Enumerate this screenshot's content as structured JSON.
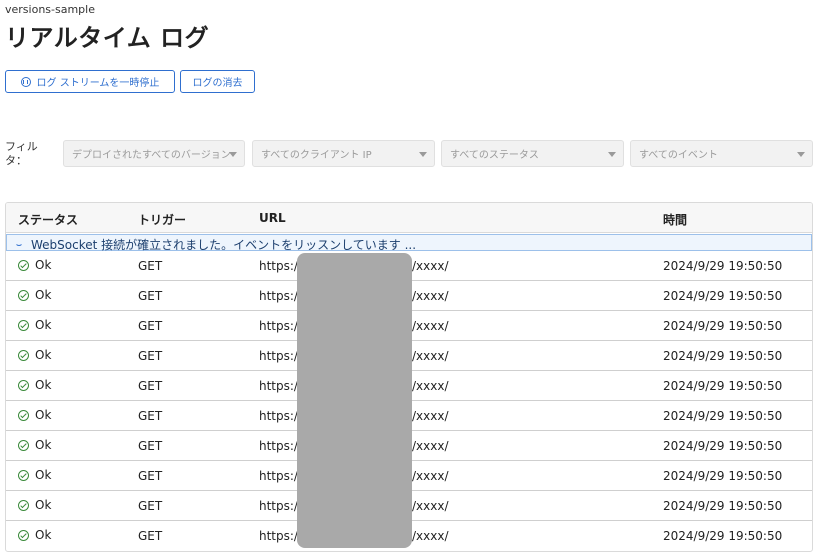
{
  "header": {
    "app_name": "versions-sample",
    "title": "リアルタイム ログ"
  },
  "toolbar": {
    "pause_label": "ログ ストリームを一時停止",
    "clear_label": "ログの消去"
  },
  "filters": {
    "label": "フィルタ：",
    "version": "デプロイされたすべてのバージョン",
    "client_ip": "すべてのクライアント IP",
    "status": "すべてのステータス",
    "event": "すべてのイベント"
  },
  "table": {
    "headers": [
      "ステータス",
      "トリガー",
      "URL",
      "時間"
    ],
    "banner": "WebSocket 接続が確立されました。イベントをリッスンしています ...",
    "rows": [
      {
        "status": "Ok",
        "trigger": "GET",
        "url_prefix": "https://",
        "url_suffix": "/xxxx/",
        "time": "2024/9/29 19:50:50"
      },
      {
        "status": "Ok",
        "trigger": "GET",
        "url_prefix": "https://",
        "url_suffix": "/xxxx/",
        "time": "2024/9/29 19:50:50"
      },
      {
        "status": "Ok",
        "trigger": "GET",
        "url_prefix": "https://",
        "url_suffix": "/xxxx/",
        "time": "2024/9/29 19:50:50"
      },
      {
        "status": "Ok",
        "trigger": "GET",
        "url_prefix": "https://",
        "url_suffix": "/xxxx/",
        "time": "2024/9/29 19:50:50"
      },
      {
        "status": "Ok",
        "trigger": "GET",
        "url_prefix": "https://",
        "url_suffix": "/xxxx/",
        "time": "2024/9/29 19:50:50"
      },
      {
        "status": "Ok",
        "trigger": "GET",
        "url_prefix": "https://",
        "url_suffix": "/xxxx/",
        "time": "2024/9/29 19:50:50"
      },
      {
        "status": "Ok",
        "trigger": "GET",
        "url_prefix": "https://",
        "url_suffix": "/xxxx/",
        "time": "2024/9/29 19:50:50"
      },
      {
        "status": "Ok",
        "trigger": "GET",
        "url_prefix": "https://",
        "url_suffix": "/xxxx/",
        "time": "2024/9/29 19:50:50"
      },
      {
        "status": "Ok",
        "trigger": "GET",
        "url_prefix": "https://",
        "url_suffix": "/xxxx/",
        "time": "2024/9/29 19:50:50"
      },
      {
        "status": "Ok",
        "trigger": "GET",
        "url_prefix": "https://",
        "url_suffix": "/xxxx/",
        "time": "2024/9/29 19:50:50"
      }
    ]
  },
  "colors": {
    "accent": "#2f6fcf",
    "ok": "#3a8a3a",
    "banner_bg": "#eef5fd",
    "redaction": "#a9a9a9"
  },
  "icons": {
    "pause": "pause-circle-icon",
    "status_ok": "check-circle-icon",
    "banner": "loading-spinner-icon",
    "dropdown": "caret-down-icon"
  }
}
